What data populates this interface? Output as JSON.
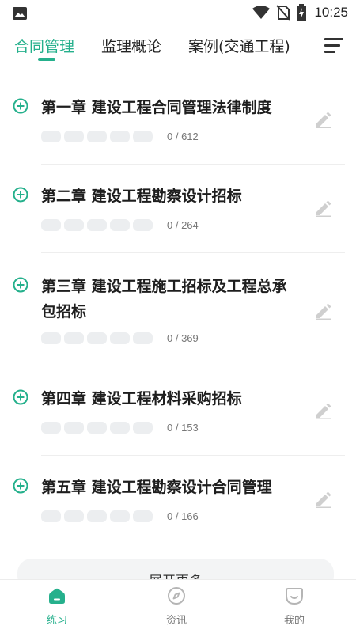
{
  "status_bar": {
    "time": "10:25",
    "icons": [
      "image-icon",
      "wifi-icon",
      "no-sim-icon",
      "battery-charging-icon"
    ]
  },
  "tabs": [
    {
      "label": "合同管理",
      "active": true
    },
    {
      "label": "监理概论",
      "active": false
    },
    {
      "label": "案例(交通工程)",
      "active": false
    }
  ],
  "menu_icon": "menu-icon",
  "chapters": [
    {
      "title": "第一章  建设工程合同管理法律制度",
      "progress": "0 / 612"
    },
    {
      "title": "第二章  建设工程勘察设计招标",
      "progress": "0 / 264"
    },
    {
      "title": "第三章  建设工程施工招标及工程总承包招标",
      "progress": "0 / 369"
    },
    {
      "title": "第四章  建设工程材料采购招标",
      "progress": "0 / 153"
    },
    {
      "title": "第五章  建设工程勘察设计合同管理",
      "progress": "0 / 166"
    }
  ],
  "expand_more": "展开更多",
  "bottom_nav": [
    {
      "label": "练习",
      "icon": "home-icon",
      "active": true
    },
    {
      "label": "资讯",
      "icon": "compass-icon",
      "active": false
    },
    {
      "label": "我的",
      "icon": "smile-icon",
      "active": false
    }
  ],
  "colors": {
    "accent": "#25b08c",
    "pill": "#eceef0",
    "text": "#1e1e1e"
  }
}
